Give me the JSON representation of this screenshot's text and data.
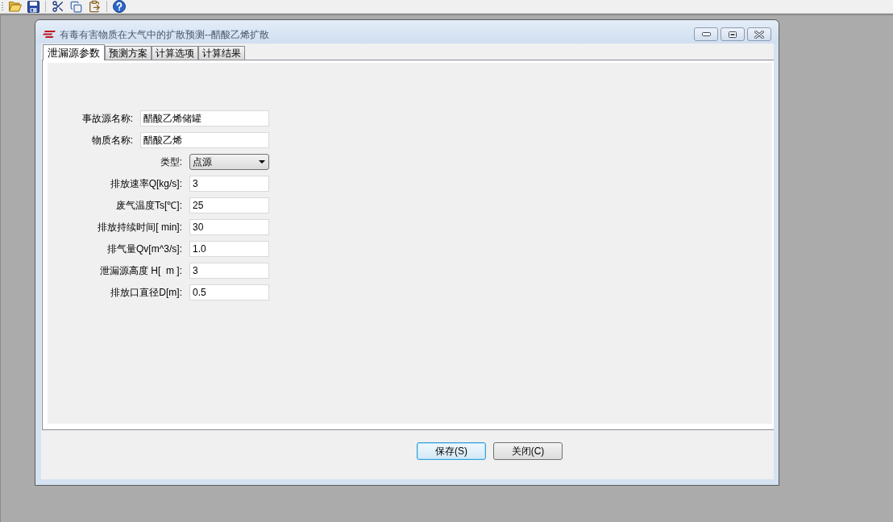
{
  "window": {
    "title": "有毒有害物质在大气中的扩散预测--醋酸乙烯扩散"
  },
  "tabs": [
    {
      "label": "泄漏源参数",
      "selected": true
    },
    {
      "label": "预测方案",
      "selected": false
    },
    {
      "label": "计算选项",
      "selected": false
    },
    {
      "label": "计算结果",
      "selected": false
    }
  ],
  "fields": [
    {
      "kind": "text",
      "label": "事故源名称:",
      "value": "醋酸乙烯储罐"
    },
    {
      "kind": "text",
      "label": "物质名称:",
      "value": "醋酸乙烯"
    },
    {
      "kind": "select",
      "label": "类型:",
      "value": "点源"
    },
    {
      "kind": "number",
      "label": "排放速率Q[kg/s]:",
      "value": "3"
    },
    {
      "kind": "number",
      "label": "废气温度Ts[℃]:",
      "value": "25"
    },
    {
      "kind": "number",
      "label": "排放持续时间[ min]:",
      "value": "30"
    },
    {
      "kind": "number",
      "label": "排气量Qv[m^3/s]:",
      "value": "1.0"
    },
    {
      "kind": "number",
      "label": "泄漏源高度 H[  m ]:",
      "value": "3"
    },
    {
      "kind": "number",
      "label": "排放口直径D[m]:",
      "value": "0.5"
    }
  ],
  "buttons": [
    {
      "label": "保存(S)",
      "default": true
    },
    {
      "label": "关闭(C)",
      "default": false
    }
  ]
}
